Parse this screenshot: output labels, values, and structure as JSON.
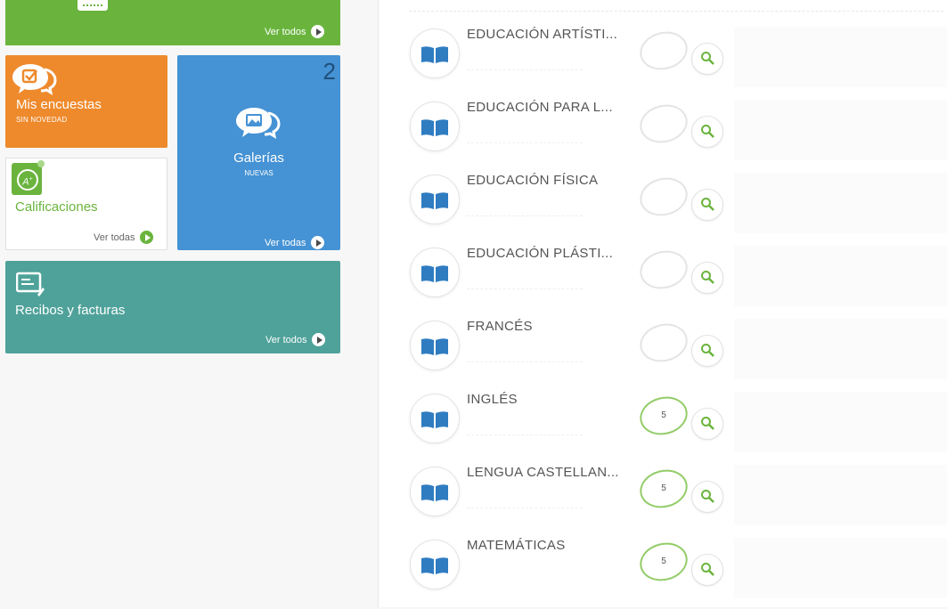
{
  "tiles": {
    "top": {
      "ver_label": "Ver todos"
    },
    "encuestas": {
      "title": "Mis encuestas",
      "status": "SIN NOVEDAD"
    },
    "galerias": {
      "count": "2",
      "title": "Galerías",
      "status": "NUEVAS",
      "ver_label": "Ver todas"
    },
    "calificaciones": {
      "title": "Calificaciones",
      "ver_label": "Ver todas"
    },
    "recibos": {
      "title": "Recibos y facturas",
      "ver_label": "Ver todos"
    }
  },
  "subjects": [
    {
      "name": "EDUCACIÓN ARTÍSTI...",
      "grade": ""
    },
    {
      "name": "EDUCACIÓN PARA L...",
      "grade": ""
    },
    {
      "name": "EDUCACIÓN FÍSICA",
      "grade": ""
    },
    {
      "name": "EDUCACIÓN PLÁSTI...",
      "grade": ""
    },
    {
      "name": "FRANCÉS",
      "grade": ""
    },
    {
      "name": "INGLÉS",
      "grade": "5"
    },
    {
      "name": "LENGUA CASTELLAN...",
      "grade": "5"
    },
    {
      "name": "MATEMÁTICAS",
      "grade": "5"
    }
  ],
  "colors": {
    "green": "#6ab43e",
    "orange": "#ee8a2c",
    "blue": "#4592d4",
    "teal": "#4fa29a",
    "book_blue": "#2f7cc1"
  },
  "icons": {
    "encuestas": "survey-chat-icon",
    "galerias": "gallery-chat-icon",
    "calificaciones": "grade-a-plus-icon",
    "recibos": "receipt-card-icon",
    "subject": "book-icon",
    "zoom": "magnifier-icon",
    "ver": "play-circle-icon"
  }
}
